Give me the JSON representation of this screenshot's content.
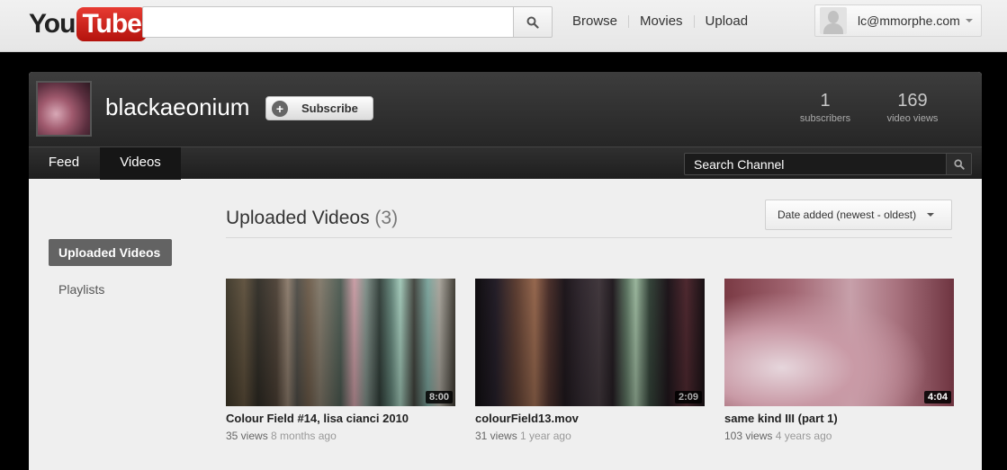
{
  "masthead": {
    "logo_you": "You",
    "logo_tube": "Tube",
    "search_placeholder": "",
    "nav": [
      "Browse",
      "Movies",
      "Upload"
    ],
    "user_email": "lc@mmorphe.com"
  },
  "channel": {
    "name": "blackaeonium",
    "subscribe_label": "Subscribe",
    "stats": [
      {
        "value": "1",
        "label": "subscribers"
      },
      {
        "value": "169",
        "label": "video views"
      }
    ],
    "tabs": [
      "Feed",
      "Videos"
    ],
    "active_tab": "Videos",
    "search_label": "Search Channel"
  },
  "sidebar": {
    "items": [
      {
        "label": "Uploaded Videos",
        "active": true
      },
      {
        "label": "Playlists",
        "active": false
      }
    ]
  },
  "main": {
    "title": "Uploaded Videos",
    "count": "(3)",
    "sort_label": "Date added (newest - oldest)",
    "videos": [
      {
        "title": "Colour Field #14, lisa cianci 2010",
        "duration": "8:00",
        "views": "35 views",
        "ago": "8 months ago"
      },
      {
        "title": "colourField13.mov",
        "duration": "2:09",
        "views": "31 views",
        "ago": "1 year ago"
      },
      {
        "title": "same kind III (part 1)",
        "duration": "4:04",
        "views": "103 views",
        "ago": "4 years ago"
      }
    ]
  },
  "colors": {
    "brand_red": "#e62117",
    "header_dark": "#2b2b2b",
    "panel_bg": "#efefef"
  },
  "icons": [
    "search-icon",
    "plus-icon",
    "chevron-down-icon",
    "avatar"
  ]
}
